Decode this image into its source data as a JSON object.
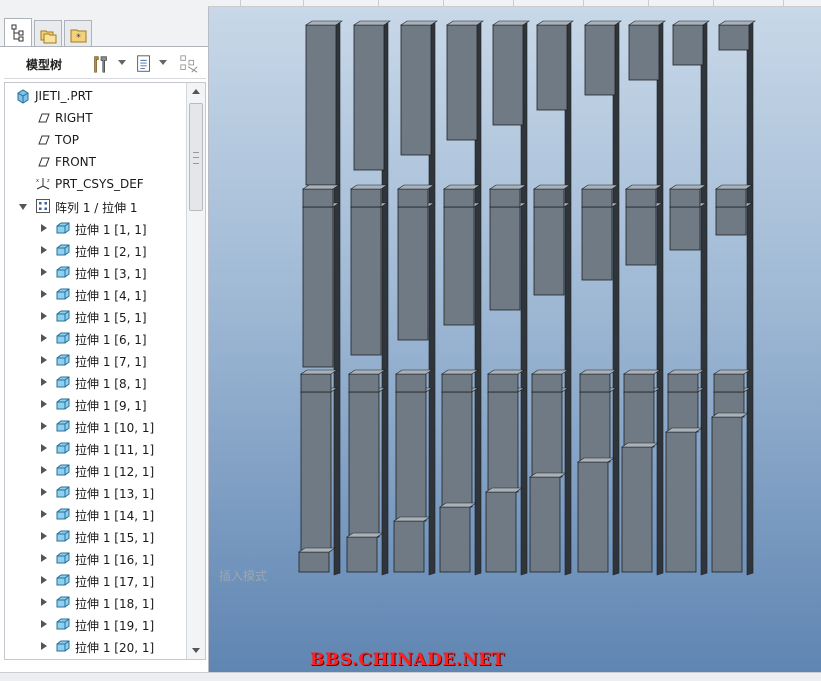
{
  "tabs": [
    {
      "name": "model-tree-tab",
      "icon": "tree-structure-icon",
      "active": true
    },
    {
      "name": "folder-browser-tab",
      "icon": "folders-icon",
      "active": false
    },
    {
      "name": "favorites-tab",
      "icon": "star-folder-icon",
      "active": false
    }
  ],
  "toolbar": {
    "tree_label": "模型树",
    "buttons": [
      "settings-tools-icon",
      "show-columns-icon",
      "filter-icon"
    ]
  },
  "tree": {
    "root": "JIETI_.PRT",
    "datums": [
      {
        "label": "RIGHT",
        "icon": "datum-plane-icon"
      },
      {
        "label": "TOP",
        "icon": "datum-plane-icon"
      },
      {
        "label": "FRONT",
        "icon": "datum-plane-icon"
      },
      {
        "label": "PRT_CSYS_DEF",
        "icon": "coordinate-system-icon"
      }
    ],
    "pattern": "阵列 1 / 拉伸 1",
    "members": [
      "拉伸 1 [1, 1]",
      "拉伸 1 [2, 1]",
      "拉伸 1 [3, 1]",
      "拉伸 1 [4, 1]",
      "拉伸 1 [5, 1]",
      "拉伸 1 [6, 1]",
      "拉伸 1 [7, 1]",
      "拉伸 1 [8, 1]",
      "拉伸 1 [9, 1]",
      "拉伸 1 [10, 1]",
      "拉伸 1 [11, 1]",
      "拉伸 1 [12, 1]",
      "拉伸 1 [13, 1]",
      "拉伸 1 [14, 1]",
      "拉伸 1 [15, 1]",
      "拉伸 1 [16, 1]",
      "拉伸 1 [17, 1]",
      "拉伸 1 [18, 1]",
      "拉伸 1 [19, 1]",
      "拉伸 1 [20, 1]"
    ]
  },
  "viewport": {
    "mode_text": "插入模式",
    "watermark": "BBS.CHINADE.NET",
    "model_color": "#6f7882",
    "background_top": "#c8d8e8",
    "background_bottom": "#5f85b2"
  }
}
